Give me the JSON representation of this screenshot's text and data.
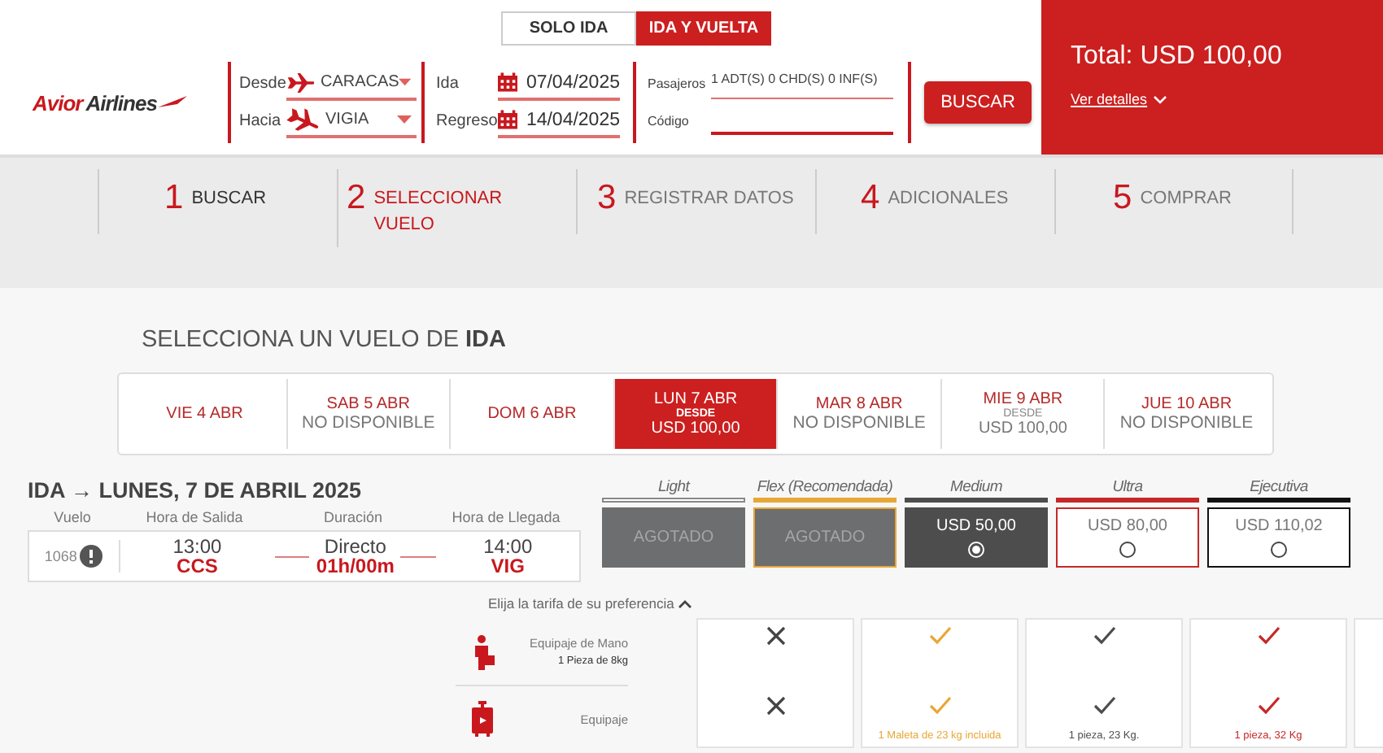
{
  "header": {
    "logo": {
      "first": "Avior",
      "second": "Airlines"
    },
    "trip_types": [
      {
        "label": "SOLO IDA",
        "selected": false
      },
      {
        "label": "IDA Y VUELTA",
        "selected": true
      }
    ],
    "route": [
      {
        "kind": "departure",
        "label": "Desde",
        "value": "CARACAS"
      },
      {
        "kind": "arrival",
        "label": "Hacia",
        "value": "VIGIA"
      }
    ],
    "dates": [
      {
        "label": "Ida",
        "value": "07/04/2025"
      },
      {
        "label": "Regreso",
        "value": "14/04/2025"
      }
    ],
    "passengers": {
      "label": "Pasajeros",
      "value": "1 ADT(S) 0 CHD(S) 0 INF(S)"
    },
    "code": {
      "label": "Código"
    },
    "search_button": "BUSCAR"
  },
  "total": {
    "text": "Total: USD 100,00",
    "link": "Ver detalles"
  },
  "steps": [
    {
      "number": "1",
      "label": "BUSCAR",
      "completed": true,
      "selected": false
    },
    {
      "number": "2",
      "label": "SELECCIONAR VUELO",
      "completed": false,
      "selected": true
    },
    {
      "number": "3",
      "label": "REGISTRAR DATOS",
      "completed": false,
      "selected": false
    },
    {
      "number": "4",
      "label": "ADICIONALES",
      "completed": false,
      "selected": false
    },
    {
      "number": "5",
      "label": "COMPRAR",
      "completed": false,
      "selected": false
    }
  ],
  "title": "SELECCIONA UN VUELO DE **IDA**",
  "days": [
    {
      "label": "VIE 4 ABR",
      "selected": false
    },
    {
      "label": "SAB 5 ABR",
      "note": "NO DISPONIBLE",
      "selected": false
    },
    {
      "label": "DOM 6 ABR",
      "selected": false
    },
    {
      "label": "LUN 7 ABR",
      "from": "DESDE",
      "price": "USD 100,00",
      "selected": true
    },
    {
      "label": "MAR 8 ABR",
      "note": "NO DISPONIBLE",
      "selected": false
    },
    {
      "label": "MIE 9 ABR",
      "from": "DESDE",
      "price": "USD 100,00",
      "selected": false
    },
    {
      "label": "JUE 10 ABR",
      "note": "NO DISPONIBLE",
      "selected": false
    }
  ],
  "flight": {
    "heading": "IDA → LUNES, 7 DE ABRIL 2025",
    "columns": [
      "Vuelo",
      "Hora de Salida",
      "Duración",
      "Hora de Llegada"
    ],
    "number": "1068",
    "departure": {
      "time": "13:00",
      "airport": "CCS"
    },
    "duration": {
      "type": "Directo",
      "time": "01h/00m"
    },
    "arrival": {
      "time": "14:00",
      "airport": "VIG"
    }
  },
  "fares": [
    {
      "name": "Light",
      "color": "#ffffff",
      "kind": "sold_out",
      "status": "AGOTADO",
      "selected": false
    },
    {
      "name": "Flex (Recomendada)",
      "color": "#e8a735",
      "kind": "sold_out",
      "status": "AGOTADO",
      "selected": false
    },
    {
      "name": "Medium",
      "color": "#4d4d4d",
      "kind": "available",
      "price": "USD 50,00",
      "selected": true
    },
    {
      "name": "Ultra",
      "color": "#c62828",
      "kind": "available",
      "price": "USD 80,00",
      "selected": false
    },
    {
      "name": "Ejecutiva",
      "color": "#111111",
      "kind": "available",
      "price": "USD 110,02",
      "selected": false
    }
  ],
  "fare_hint": "Elija la tarifa de su preferencia",
  "baggage": [
    {
      "kind": "carry_on",
      "label": "Equipaje de Mano",
      "detail": "1 Pieza de 8kg",
      "cells": [
        {
          "included": false
        },
        {
          "included": true
        },
        {
          "included": true
        },
        {
          "included": true
        }
      ]
    },
    {
      "kind": "checked",
      "label": "Equipaje",
      "cells": [
        {
          "included": false
        },
        {
          "included": true,
          "note": "1 Maleta de 23 kg incluida"
        },
        {
          "included": true,
          "note": "1 pieza, 23 Kg."
        },
        {
          "included": true,
          "note": "1 pieza, 32 Kg"
        }
      ]
    }
  ]
}
